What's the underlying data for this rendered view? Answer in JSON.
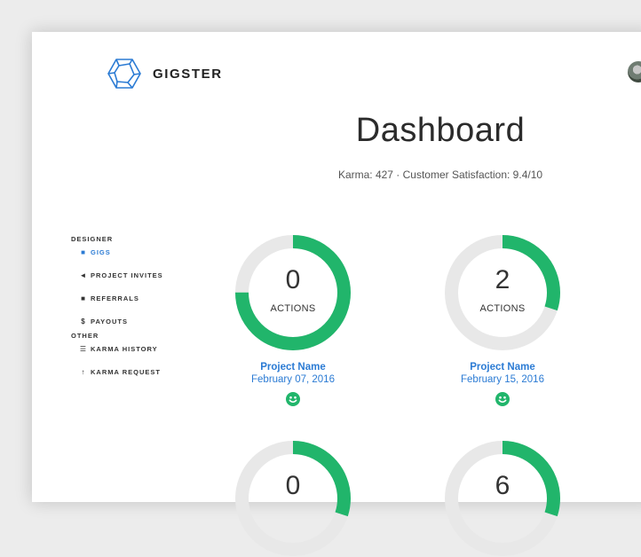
{
  "brand": {
    "name": "GIGSTER",
    "accent": "#2b7bd4",
    "ring_green": "#21b56b",
    "ring_gray": "#e8e8e8"
  },
  "header": {
    "title": "Dashboard",
    "subtitle": "Karma: 427 · Customer Satisfaction: 9.4/10"
  },
  "sidebar": {
    "sections": [
      {
        "label": "DESIGNER",
        "items": [
          {
            "label": "GIGS",
            "icon": "briefcase-icon",
            "active": true
          },
          {
            "label": "PROJECT INVITES",
            "icon": "megaphone-icon"
          },
          {
            "label": "REFERRALS",
            "icon": "users-icon"
          },
          {
            "label": "PAYOUTS",
            "icon": "dollar-icon"
          }
        ]
      },
      {
        "label": "OTHER",
        "items": [
          {
            "label": "KARMA HISTORY",
            "icon": "list-icon"
          },
          {
            "label": "KARMA REQUEST",
            "icon": "arrow-up-icon"
          }
        ]
      }
    ]
  },
  "gigs": [
    {
      "count": "0",
      "label": "ACTIONS",
      "project": "Project Name",
      "date": "February 07, 2016",
      "progress": 0.75,
      "status_icon": "smile-icon"
    },
    {
      "count": "2",
      "label": "ACTIONS",
      "project": "Project Name",
      "date": "February 15, 2016",
      "progress": 0.3,
      "status_icon": "smile-icon"
    },
    {
      "count": "0",
      "progress": 0.3
    },
    {
      "count": "6",
      "progress": 0.3
    }
  ]
}
